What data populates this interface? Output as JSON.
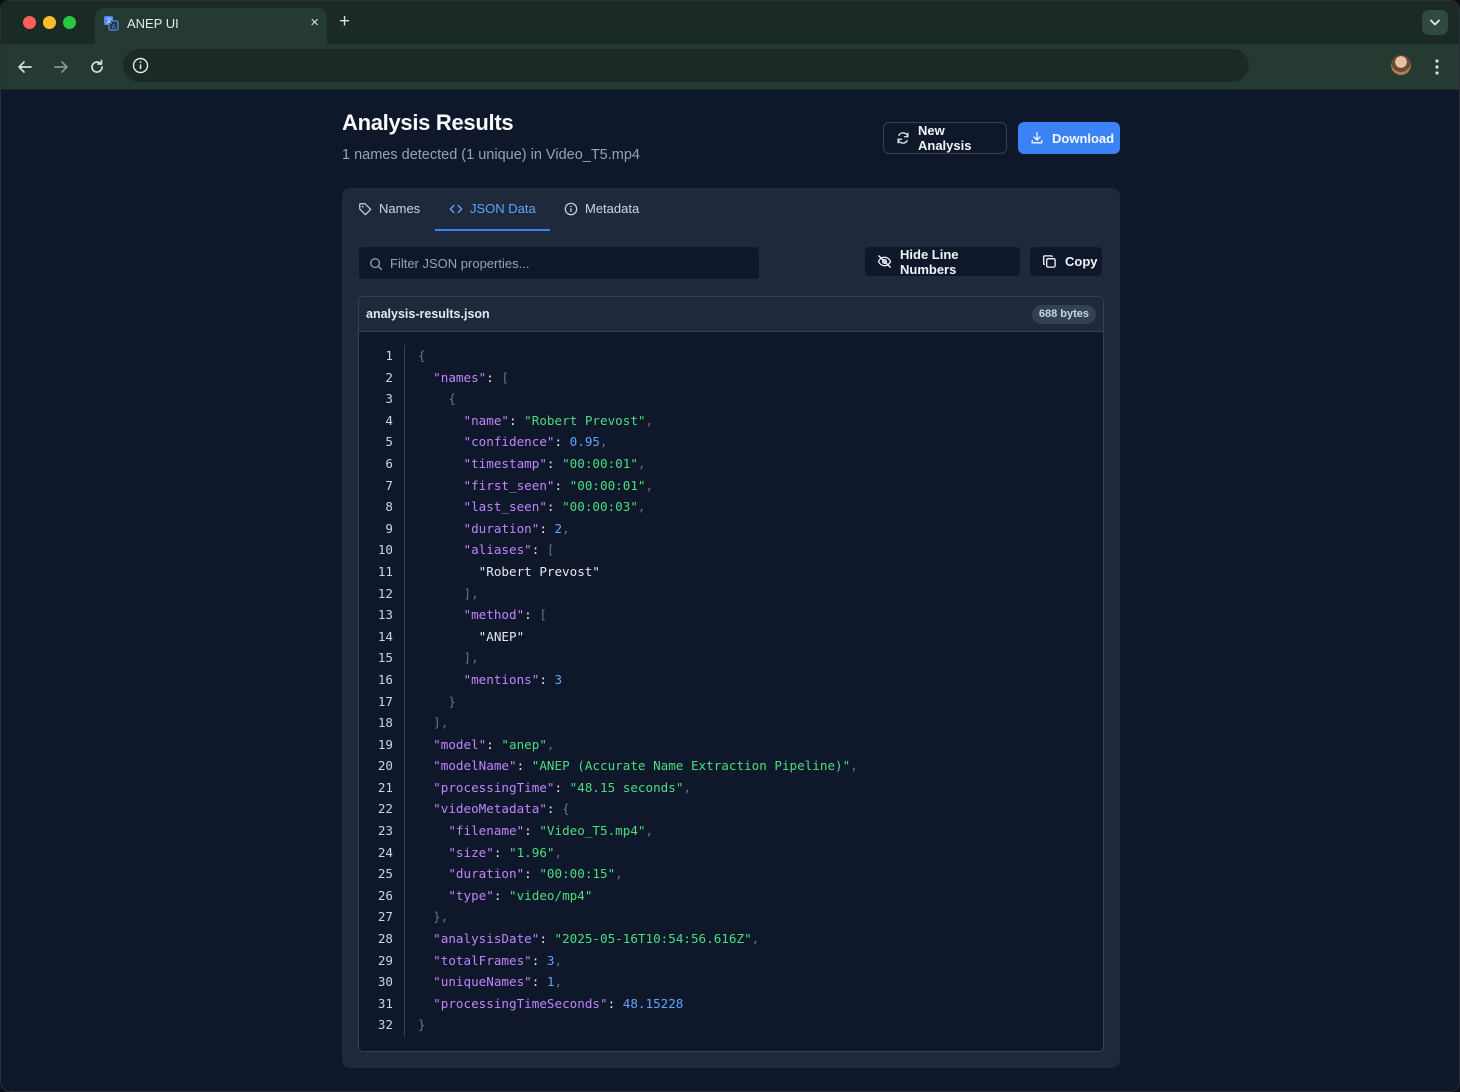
{
  "browser": {
    "tab_title": "ANEP UI",
    "tab_close": "×",
    "new_tab": "+"
  },
  "header": {
    "title": "Analysis Results",
    "subtitle": "1 names detected (1 unique) in Video_T5.mp4",
    "new_analysis_label": "New Analysis",
    "download_label": "Download"
  },
  "tabs": [
    {
      "label": "Names",
      "icon": "tag-icon",
      "active": false
    },
    {
      "label": "JSON Data",
      "icon": "code-icon",
      "active": true
    },
    {
      "label": "Metadata",
      "icon": "info-icon",
      "active": false
    }
  ],
  "json_view": {
    "filter_placeholder": "Filter JSON properties...",
    "filter_value": "",
    "hide_line_numbers_label": "Hide Line Numbers",
    "copy_label": "Copy",
    "file_name": "analysis-results.json",
    "file_size": "688 bytes",
    "lines": [
      {
        "n": "1",
        "t": [
          [
            "p",
            "{"
          ]
        ]
      },
      {
        "n": "2",
        "t": [
          [
            "w",
            "  "
          ],
          [
            "k",
            "\"names\""
          ],
          [
            "w",
            ": "
          ],
          [
            "p",
            "["
          ]
        ]
      },
      {
        "n": "3",
        "t": [
          [
            "w",
            "    "
          ],
          [
            "p",
            "{"
          ]
        ]
      },
      {
        "n": "4",
        "t": [
          [
            "w",
            "      "
          ],
          [
            "k",
            "\"name\""
          ],
          [
            "w",
            ": "
          ],
          [
            "s",
            "\"Robert Prevost\""
          ],
          [
            "p",
            ","
          ]
        ]
      },
      {
        "n": "5",
        "t": [
          [
            "w",
            "      "
          ],
          [
            "k",
            "\"confidence\""
          ],
          [
            "w",
            ": "
          ],
          [
            "n",
            "0.95"
          ],
          [
            "p",
            ","
          ]
        ]
      },
      {
        "n": "6",
        "t": [
          [
            "w",
            "      "
          ],
          [
            "k",
            "\"timestamp\""
          ],
          [
            "w",
            ": "
          ],
          [
            "s",
            "\"00:00:01\""
          ],
          [
            "p",
            ","
          ]
        ]
      },
      {
        "n": "7",
        "t": [
          [
            "w",
            "      "
          ],
          [
            "k",
            "\"first_seen\""
          ],
          [
            "w",
            ": "
          ],
          [
            "s",
            "\"00:00:01\""
          ],
          [
            "p",
            ","
          ]
        ]
      },
      {
        "n": "8",
        "t": [
          [
            "w",
            "      "
          ],
          [
            "k",
            "\"last_seen\""
          ],
          [
            "w",
            ": "
          ],
          [
            "s",
            "\"00:00:03\""
          ],
          [
            "p",
            ","
          ]
        ]
      },
      {
        "n": "9",
        "t": [
          [
            "w",
            "      "
          ],
          [
            "k",
            "\"duration\""
          ],
          [
            "w",
            ": "
          ],
          [
            "n",
            "2"
          ],
          [
            "p",
            ","
          ]
        ]
      },
      {
        "n": "10",
        "t": [
          [
            "w",
            "      "
          ],
          [
            "k",
            "\"aliases\""
          ],
          [
            "w",
            ": "
          ],
          [
            "p",
            "["
          ]
        ]
      },
      {
        "n": "11",
        "t": [
          [
            "w",
            "        \"Robert Prevost\""
          ]
        ]
      },
      {
        "n": "12",
        "t": [
          [
            "w",
            "      "
          ],
          [
            "p",
            "],"
          ]
        ]
      },
      {
        "n": "13",
        "t": [
          [
            "w",
            "      "
          ],
          [
            "k",
            "\"method\""
          ],
          [
            "w",
            ": "
          ],
          [
            "p",
            "["
          ]
        ]
      },
      {
        "n": "14",
        "t": [
          [
            "w",
            "        \"ANEP\""
          ]
        ]
      },
      {
        "n": "15",
        "t": [
          [
            "w",
            "      "
          ],
          [
            "p",
            "],"
          ]
        ]
      },
      {
        "n": "16",
        "t": [
          [
            "w",
            "      "
          ],
          [
            "k",
            "\"mentions\""
          ],
          [
            "w",
            ": "
          ],
          [
            "n",
            "3"
          ]
        ]
      },
      {
        "n": "17",
        "t": [
          [
            "w",
            "    "
          ],
          [
            "p",
            "}"
          ]
        ]
      },
      {
        "n": "18",
        "t": [
          [
            "w",
            "  "
          ],
          [
            "p",
            "],"
          ]
        ]
      },
      {
        "n": "19",
        "t": [
          [
            "w",
            "  "
          ],
          [
            "k",
            "\"model\""
          ],
          [
            "w",
            ": "
          ],
          [
            "s",
            "\"anep\""
          ],
          [
            "p",
            ","
          ]
        ]
      },
      {
        "n": "20",
        "t": [
          [
            "w",
            "  "
          ],
          [
            "k",
            "\"modelName\""
          ],
          [
            "w",
            ": "
          ],
          [
            "s",
            "\"ANEP (Accurate Name Extraction Pipeline)\""
          ],
          [
            "p",
            ","
          ]
        ]
      },
      {
        "n": "21",
        "t": [
          [
            "w",
            "  "
          ],
          [
            "k",
            "\"processingTime\""
          ],
          [
            "w",
            ": "
          ],
          [
            "s",
            "\"48.15 seconds\""
          ],
          [
            "p",
            ","
          ]
        ]
      },
      {
        "n": "22",
        "t": [
          [
            "w",
            "  "
          ],
          [
            "k",
            "\"videoMetadata\""
          ],
          [
            "w",
            ": "
          ],
          [
            "p",
            "{"
          ]
        ]
      },
      {
        "n": "23",
        "t": [
          [
            "w",
            "    "
          ],
          [
            "k",
            "\"filename\""
          ],
          [
            "w",
            ": "
          ],
          [
            "s",
            "\"Video_T5.mp4\""
          ],
          [
            "p",
            ","
          ]
        ]
      },
      {
        "n": "24",
        "t": [
          [
            "w",
            "    "
          ],
          [
            "k",
            "\"size\""
          ],
          [
            "w",
            ": "
          ],
          [
            "s",
            "\"1.96\""
          ],
          [
            "p",
            ","
          ]
        ]
      },
      {
        "n": "25",
        "t": [
          [
            "w",
            "    "
          ],
          [
            "k",
            "\"duration\""
          ],
          [
            "w",
            ": "
          ],
          [
            "s",
            "\"00:00:15\""
          ],
          [
            "p",
            ","
          ]
        ]
      },
      {
        "n": "26",
        "t": [
          [
            "w",
            "    "
          ],
          [
            "k",
            "\"type\""
          ],
          [
            "w",
            ": "
          ],
          [
            "s",
            "\"video/mp4\""
          ]
        ]
      },
      {
        "n": "27",
        "t": [
          [
            "w",
            "  "
          ],
          [
            "p",
            "},"
          ]
        ]
      },
      {
        "n": "28",
        "t": [
          [
            "w",
            "  "
          ],
          [
            "k",
            "\"analysisDate\""
          ],
          [
            "w",
            ": "
          ],
          [
            "s",
            "\"2025-05-16T10:54:56.616Z\""
          ],
          [
            "p",
            ","
          ]
        ]
      },
      {
        "n": "29",
        "t": [
          [
            "w",
            "  "
          ],
          [
            "k",
            "\"totalFrames\""
          ],
          [
            "w",
            ": "
          ],
          [
            "n",
            "3"
          ],
          [
            "p",
            ","
          ]
        ]
      },
      {
        "n": "30",
        "t": [
          [
            "w",
            "  "
          ],
          [
            "k",
            "\"uniqueNames\""
          ],
          [
            "w",
            ": "
          ],
          [
            "n",
            "1"
          ],
          [
            "p",
            ","
          ]
        ]
      },
      {
        "n": "31",
        "t": [
          [
            "w",
            "  "
          ],
          [
            "k",
            "\"processingTimeSeconds\""
          ],
          [
            "w",
            ": "
          ],
          [
            "n",
            "48.15228"
          ]
        ]
      },
      {
        "n": "32",
        "t": [
          [
            "p",
            "}"
          ]
        ]
      }
    ]
  },
  "colors": {
    "accent": "#3b82f6",
    "json_key": "#c084fc",
    "json_string": "#4ade80",
    "json_number": "#60a5fa",
    "json_punct": "#64748b"
  }
}
